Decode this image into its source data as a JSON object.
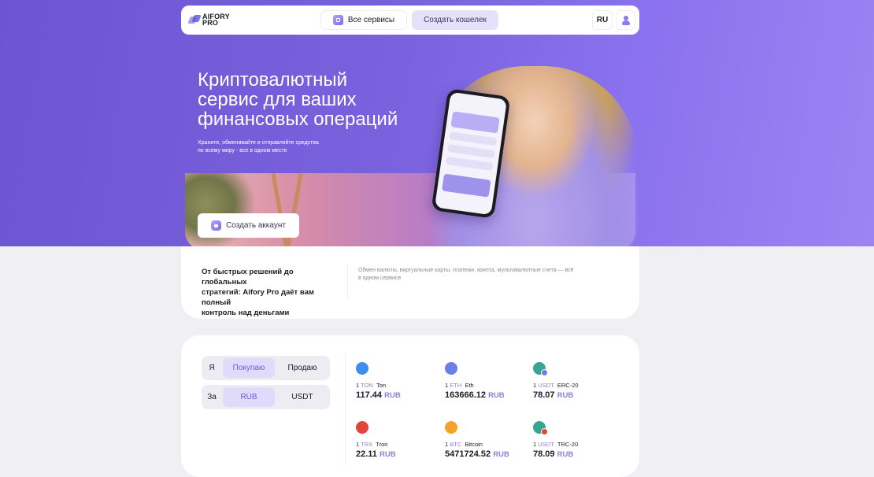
{
  "nav": {
    "logo_line1": "AIFORY",
    "logo_line2": "PRO",
    "services_label": "Все сервисы",
    "create_wallet_label": "Создать кошелек",
    "lang_label": "RU"
  },
  "hero": {
    "title_lines": [
      "Криптовалютный",
      "сервис для ваших",
      "финансовых операций"
    ],
    "subtitle_lines": [
      "Храните, обменивайте и отправляйте средства",
      "по всему миру - все в одном месте"
    ],
    "create_account_label": "Создать аккаунт"
  },
  "info": {
    "left_lines": [
      "От быстрых решений до глобальных",
      "стратегий: Aifory Pro даёт вам полный",
      "контроль над деньгами"
    ],
    "right_lines": [
      "Обмен валюты, виртуальные карты, платежи, крипта, мультивалютные счета — всё",
      "в одном сервисе"
    ]
  },
  "exchange": {
    "row1": {
      "label": "Я",
      "options": [
        "Покупаю",
        "Продаю"
      ],
      "selected": "Покупаю"
    },
    "row2": {
      "label": "За",
      "options": [
        "RUB",
        "USDT"
      ],
      "selected": "RUB"
    }
  },
  "rates": [
    {
      "amount": "1",
      "code": "TON",
      "name": "Ton",
      "value": "117.44",
      "currency": "RUB",
      "icon": "ton-icon",
      "color": "#3d8ef0"
    },
    {
      "amount": "1",
      "code": "ETH",
      "name": "Eth",
      "value": "163666.12",
      "currency": "RUB",
      "icon": "eth-icon",
      "color": "#6c7fe6"
    },
    {
      "amount": "1",
      "code": "USDT",
      "name": "ERC-20",
      "value": "78.07",
      "currency": "RUB",
      "icon": "usdt-erc20-icon",
      "color": "#3aa58f",
      "badge_color": "#6c7fe6"
    },
    {
      "amount": "1",
      "code": "TRX",
      "name": "Tron",
      "value": "22.11",
      "currency": "RUB",
      "icon": "trx-icon",
      "color": "#e0463a"
    },
    {
      "amount": "1",
      "code": "BTC",
      "name": "Bitcoin",
      "value": "5471724.52",
      "currency": "RUB",
      "icon": "btc-icon",
      "color": "#f0a42a"
    },
    {
      "amount": "1",
      "code": "USDT",
      "name": "TRC-20",
      "value": "78.09",
      "currency": "RUB",
      "icon": "usdt-trc20-icon",
      "color": "#3aa58f",
      "badge_color": "#e0463a"
    }
  ]
}
